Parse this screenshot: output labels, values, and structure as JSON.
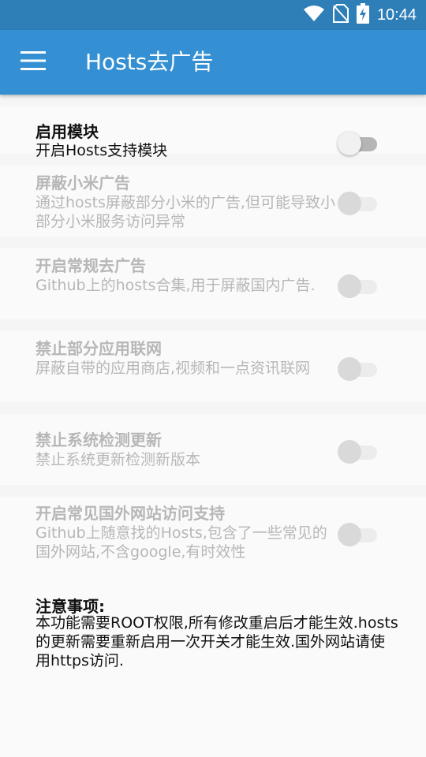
{
  "status_bar": {
    "time": "10:44",
    "icons": [
      "wifi-icon",
      "no-sim-icon",
      "battery-charging-icon"
    ]
  },
  "app_bar": {
    "menu_icon": "hamburger-menu-icon",
    "title": "Hosts去广告",
    "color": "#3490d2"
  },
  "settings": [
    {
      "title": "启用模块",
      "description": "开启Hosts支持模块",
      "enabled": true,
      "on": false
    },
    {
      "title": "屏蔽小米广告",
      "description": "通过hosts屏蔽部分小米的广告,但可能导致小部分小米服务访问异常",
      "enabled": false,
      "on": false
    },
    {
      "title": "开启常规去广告",
      "description": "Github上的hosts合集,用于屏蔽国内广告.",
      "enabled": false,
      "on": false
    },
    {
      "title": "禁止部分应用联网",
      "description": "屏蔽自带的应用商店,视频和一点资讯联网",
      "enabled": false,
      "on": false
    },
    {
      "title": "禁止系统检测更新",
      "description": "禁止系统更新检测新版本",
      "enabled": false,
      "on": false
    },
    {
      "title": "开启常见国外网站访问支持",
      "description": "Github上随意找的Hosts,包含了一些常见的国外网站,不含google,有时效性",
      "enabled": false,
      "on": false
    }
  ],
  "notes": {
    "title": "注意事项:",
    "body": "本功能需要ROOT权限,所有修改重启后才能生效.hosts的更新需要重新启用一次开关才能生效.国外网站请使用https访问."
  }
}
